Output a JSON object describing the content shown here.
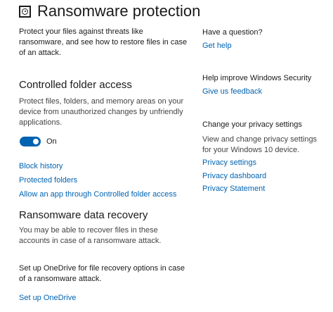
{
  "page": {
    "title": "Ransomware protection",
    "intro_lines": [
      "Protect your files against threats like",
      "ransomware, and see how to restore files in case",
      "of an attack."
    ]
  },
  "controlled_folder_access": {
    "heading": "Controlled folder access",
    "description_lines": [
      "Protect files, folders, and memory areas on your",
      "device from unauthorized changes by unfriendly",
      "applications."
    ],
    "toggle_state": "On",
    "links": {
      "block_history": "Block history",
      "protected_folders": "Protected folders",
      "allow_app": "Allow an app through Controlled folder access"
    }
  },
  "recovery": {
    "heading": "Ransomware data recovery",
    "description_lines": [
      "You may be able to recover files in these",
      "accounts in case of a ransomware attack."
    ],
    "onedrive_lines": [
      "Set up OneDrive for file recovery options in case",
      "of a ransomware attack."
    ],
    "setup_link": "Set up OneDrive"
  },
  "sidebar": {
    "question_heading": "Have a question?",
    "get_help": "Get help",
    "improve_heading": "Help improve Windows Security",
    "feedback": "Give us feedback",
    "privacy_heading": "Change your privacy settings",
    "privacy_description_lines": [
      "View and change privacy settings",
      "for your Windows 10 device."
    ],
    "privacy_settings": "Privacy settings",
    "privacy_dashboard": "Privacy dashboard",
    "privacy_statement": "Privacy Statement"
  },
  "colors": {
    "accent": "#0063b1",
    "text": "#1a1a1a",
    "secondary_text": "#444444",
    "background": "#ffffff"
  }
}
